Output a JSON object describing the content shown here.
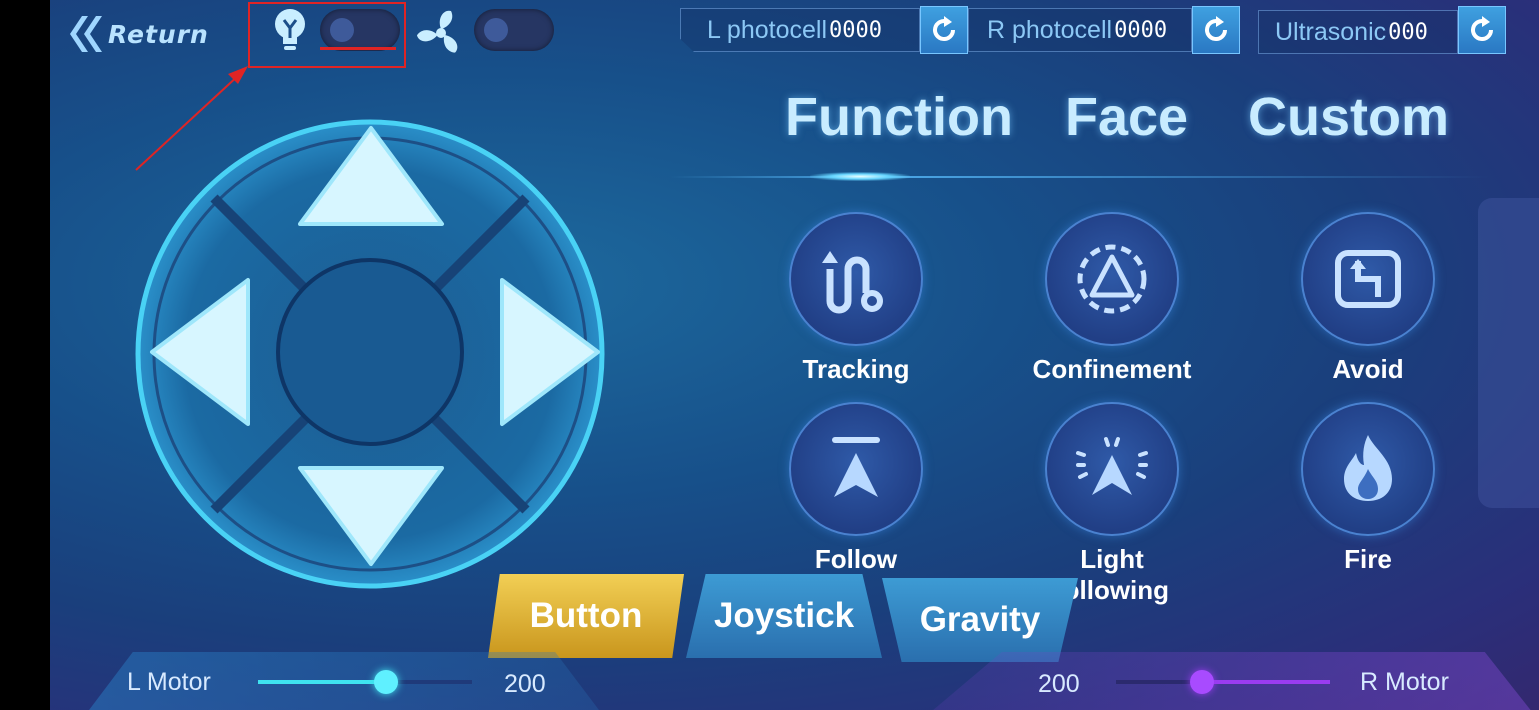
{
  "topbar": {
    "return_label": "Return",
    "sensors": [
      {
        "name": "L photocell",
        "value": "0000"
      },
      {
        "name": "R photocell",
        "value": "0000"
      },
      {
        "name": "Ultrasonic",
        "value": "000"
      }
    ]
  },
  "toggles": {
    "light": {
      "state": "off"
    },
    "fan": {
      "state": "off"
    }
  },
  "tabs": [
    "Function",
    "Face",
    "Custom"
  ],
  "functions": [
    {
      "label": "Tracking",
      "icon": "tracking-icon"
    },
    {
      "label": "Confinement",
      "icon": "confinement-icon"
    },
    {
      "label": "Avoid",
      "icon": "avoid-icon"
    },
    {
      "label": "Follow",
      "icon": "follow-icon"
    },
    {
      "label": "Light following",
      "icon": "light-following-icon"
    },
    {
      "label": "Fire",
      "icon": "fire-icon"
    }
  ],
  "modes": [
    {
      "label": "Button",
      "active": true
    },
    {
      "label": "Joystick",
      "active": false
    },
    {
      "label": "Gravity",
      "active": false
    }
  ],
  "motors": {
    "left": {
      "label": "L Motor",
      "value": "200",
      "level": 0.6
    },
    "right": {
      "label": "R Motor",
      "value": "200",
      "level": 0.4
    }
  },
  "colors": {
    "accent": "#3fe3f0",
    "right_motor": "#9a3cf0",
    "active_mode": "#e8b830",
    "annotation": "#e02424"
  }
}
